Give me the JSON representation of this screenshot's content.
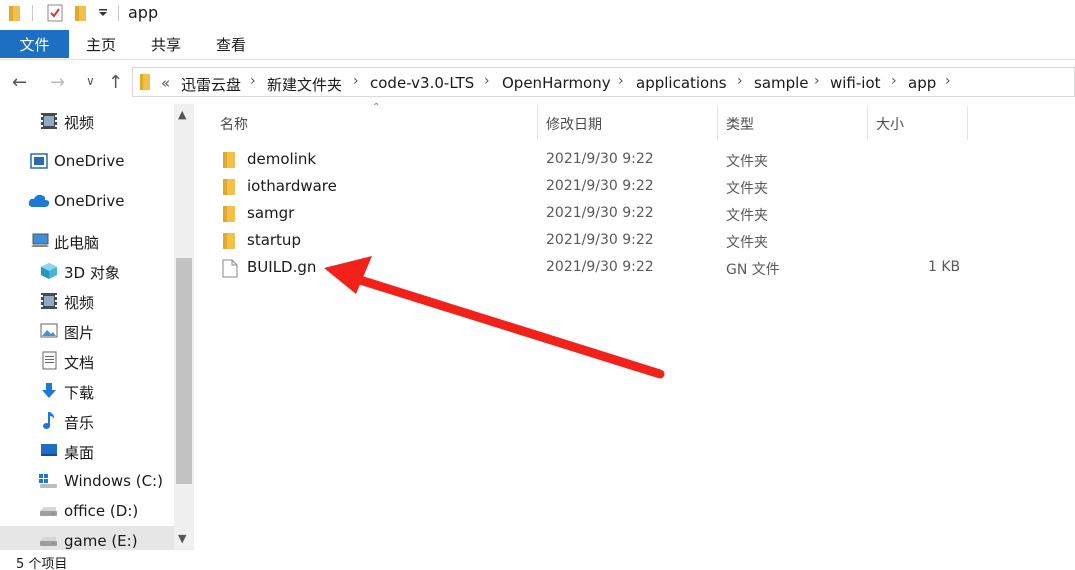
{
  "window": {
    "title": "app"
  },
  "ribbon": {
    "file_tab": "文件",
    "tabs": [
      "主页",
      "共享",
      "查看"
    ]
  },
  "address": {
    "overflow": "«",
    "crumbs": [
      "迅雷云盘",
      "新建文件夹",
      "code-v3.0-LTS",
      "OpenHarmony",
      "applications",
      "sample",
      "wifi-iot",
      "app"
    ]
  },
  "sidebar": {
    "items": [
      {
        "label": "视频",
        "icon": "video-icon"
      },
      {
        "label": "OneDrive",
        "icon": "onedrive-box-icon"
      },
      {
        "label": "OneDrive",
        "icon": "cloud-icon"
      },
      {
        "label": "此电脑",
        "icon": "computer-icon"
      },
      {
        "label": "3D 对象",
        "icon": "3d-objects-icon"
      },
      {
        "label": "视频",
        "icon": "video-icon"
      },
      {
        "label": "图片",
        "icon": "pictures-icon"
      },
      {
        "label": "文档",
        "icon": "documents-icon"
      },
      {
        "label": "下载",
        "icon": "download-icon"
      },
      {
        "label": "音乐",
        "icon": "music-icon"
      },
      {
        "label": "桌面",
        "icon": "desktop-icon"
      },
      {
        "label": "Windows (C:)",
        "icon": "windows-drive-icon"
      },
      {
        "label": "office (D:)",
        "icon": "drive-icon"
      },
      {
        "label": "game (E:)",
        "icon": "drive-icon"
      }
    ]
  },
  "columns": {
    "name": "名称",
    "modified": "修改日期",
    "type": "类型",
    "size": "大小"
  },
  "files": [
    {
      "name": "demolink",
      "modified": "2021/9/30 9:22",
      "type": "文件夹",
      "size": "",
      "icon": "folder-icon"
    },
    {
      "name": "iothardware",
      "modified": "2021/9/30 9:22",
      "type": "文件夹",
      "size": "",
      "icon": "folder-icon"
    },
    {
      "name": "samgr",
      "modified": "2021/9/30 9:22",
      "type": "文件夹",
      "size": "",
      "icon": "folder-icon"
    },
    {
      "name": "startup",
      "modified": "2021/9/30 9:22",
      "type": "文件夹",
      "size": "",
      "icon": "folder-icon"
    },
    {
      "name": "BUILD.gn",
      "modified": "2021/9/30 9:22",
      "type": "GN 文件",
      "size": "1 KB",
      "icon": "file-icon"
    }
  ],
  "status": {
    "count": "5 个项目"
  },
  "colors": {
    "accent": "#1d6fc2",
    "annotation_arrow": "#f2211a",
    "folder": "#f3c14b"
  }
}
